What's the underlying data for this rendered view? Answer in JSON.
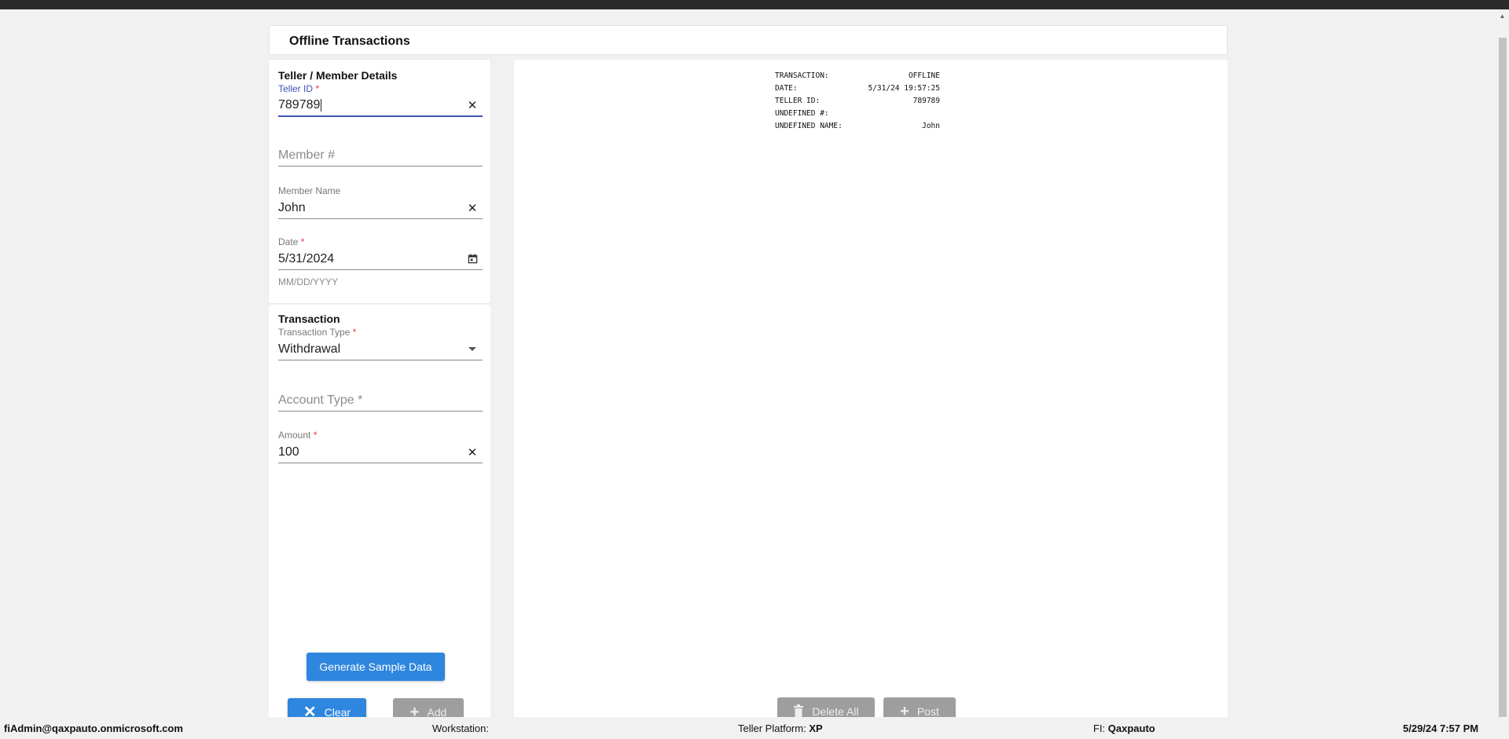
{
  "page": {
    "title": "Offline Transactions"
  },
  "teller_section": {
    "title": "Teller / Member Details",
    "teller_id": {
      "label": "Teller ID",
      "required": "*",
      "value": "789789"
    },
    "member_number": {
      "placeholder": "Member #"
    },
    "member_name": {
      "label": "Member Name",
      "value": "John"
    },
    "date": {
      "label": "Date",
      "required": "*",
      "value": "5/31/2024",
      "hint": "MM/DD/YYYY"
    }
  },
  "transaction_section": {
    "title": "Transaction",
    "transaction_type": {
      "label": "Transaction Type",
      "required": "*",
      "value": "Withdrawal"
    },
    "account_type": {
      "placeholder": "Account Type *"
    },
    "amount": {
      "label": "Amount",
      "required": "*",
      "value": "100"
    }
  },
  "buttons": {
    "generate": "Generate Sample Data",
    "clear": "Clear",
    "add": "Add",
    "delete_all": "Delete All",
    "post": "Post"
  },
  "receipt": [
    {
      "key": "TRANSACTION:",
      "value": "OFFLINE"
    },
    {
      "key": "DATE:",
      "value": "5/31/24 19:57:25"
    },
    {
      "key": "TELLER ID:",
      "value": "789789"
    },
    {
      "key": "UNDEFINED #:",
      "value": ""
    },
    {
      "key": "UNDEFINED NAME:",
      "value": "John"
    }
  ],
  "status_bar": {
    "user": "fiAdmin@qaxpauto.onmicrosoft.com",
    "workstation_label": "Workstation:",
    "platform_label": "Teller Platform:",
    "platform_value": "XP",
    "fi_label": "FI:",
    "fi_value": "Qaxpauto",
    "datetime": "5/29/24 7:57 PM"
  },
  "icons": {
    "clear": "close-icon",
    "calendar": "calendar-icon",
    "dropdown": "dropdown-arrow-icon",
    "delete": "trash-icon",
    "add": "plus-icon"
  },
  "colors": {
    "primary": "#2e86de",
    "focus": "#3f51b5",
    "required": "#e53935",
    "disabled": "#9e9e9e"
  }
}
